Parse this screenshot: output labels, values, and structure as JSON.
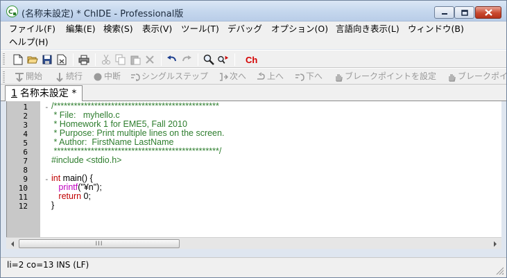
{
  "window": {
    "title": "(名称未設定) * ChIDE - Professional版"
  },
  "menu": {
    "row1": [
      "ファイル(F)",
      "編集(E)",
      "検索(S)",
      "表示(V)",
      "ツール(T)",
      "デバッグ",
      "オプション(O)",
      "言語向き表示(L)",
      "ウィンドウ(B)"
    ],
    "row2": [
      "ヘルプ(H)"
    ]
  },
  "toolbar2": {
    "items": [
      "開始",
      "続行",
      "中断",
      "シングルステップ",
      "次へ",
      "上へ",
      "下へ",
      "ブレークポイントを設定",
      "ブレークポイ"
    ]
  },
  "tab": {
    "number": "1",
    "label": "名称未設定 *"
  },
  "editor": {
    "line_numbers": [
      "1",
      "2",
      "3",
      "4",
      "5",
      "6",
      "7",
      "8",
      "9",
      "10",
      "11",
      "12"
    ],
    "lines": [
      "/*************************************************",
      " * File:   myhello.c",
      " * Homework 1 for EME5, Fall 2010",
      " * Purpose: Print multiple lines on the screen.",
      " * Author:  FirstName LastName",
      " *************************************************/",
      "#include <stdio.h>",
      "",
      "int main() {",
      "   printf(\"¥n\");",
      "   return 0;",
      "}"
    ]
  },
  "status": {
    "text": "li=2 co=13 INS (LF)"
  },
  "colors": {
    "comment": "#2d7d2d",
    "keyword": "#c00000",
    "function": "#c000c0",
    "gutter": "#c8c8c8"
  }
}
